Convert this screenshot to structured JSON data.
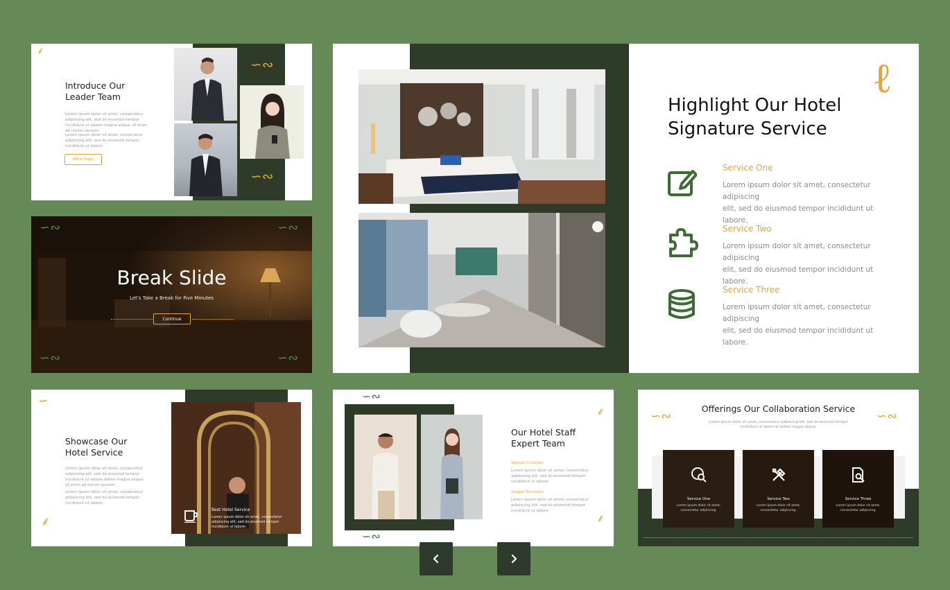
{
  "slide1": {
    "title": "Introduce Our Leader Team",
    "paragraph1": "Lorem ipsum dolor sit amet, consectetur adipiscing elit, sed do eiusmod tempor incididunt ut labore magna aliqua. Ut enim ad minim veniam.",
    "paragraph2": "Lorem ipsum dolor sit amet, consectetur adipiscing elit, sed do eiusmod tempor incididunt ut labore.",
    "button": "More Team"
  },
  "slide2": {
    "title": "Break Slide",
    "subtitle": "Let's Take a Break for Five Minutes",
    "button": "Continue"
  },
  "main": {
    "title_line1": "Highlight Our Hotel",
    "title_line2": "Signature Service",
    "services": [
      {
        "icon": "edit-icon",
        "title": "Service One",
        "desc1": "Lorem ipsum dolor sit amet, consectetur adipiscing",
        "desc2": "elit, sed do eiusmod tempor incididunt ut labore."
      },
      {
        "icon": "puzzle-icon",
        "title": "Service Two",
        "desc1": "Lorem ipsum dolor sit amet, consectetur adipiscing",
        "desc2": "elit, sed do eiusmod tempor incididunt ut labore."
      },
      {
        "icon": "database-icon",
        "title": "Service Three",
        "desc1": "Lorem ipsum dolor sit amet, consectetur adipiscing",
        "desc2": "elit, sed do eiusmod tempor incididunt ut labore."
      }
    ]
  },
  "slide4": {
    "title": "Showcase Our Hotel Service",
    "paragraph1": "Lorem ipsum dolor sit amet, consectetur adipiscing elit, sed do eiusmod tempor incididunt ut labore dolore magna aliqua. Ut enim ad minim veniam.",
    "paragraph2": "Lorem ipsum dolor sit amet, consectetur adipiscing elit, sed do eiusmod tempor incididunt ut labore.",
    "caption_title": "Best Hotel Service",
    "caption_text": "Lorem ipsum dolor sit amet, consectetur adipiscing elit, sed do eiusmod tempor incididunt ut labore."
  },
  "slide5": {
    "title": "Our Hotel Staff Expert Team",
    "member1": "Samuel Christian",
    "member1_text": "Lorem ipsum dolor sit amet, consectetur adipiscing elit, sed do eiusmod tempor incididunt ut labore.",
    "member2": "Sergen Romanov",
    "member2_text": "Lorem ipsum dolor sit amet, consectetur adipiscing elit, sed do eiusmod tempor incididunt ut labore."
  },
  "slide6": {
    "title": "Offerings Our Collaboration Service",
    "subtitle": "Lorem ipsum dolor sit amet, consectetur adipiscing elit, sed do eiusmod tempor incididunt ut labore et dolore magna aliqua.",
    "cards": [
      {
        "icon": "globe-search-icon",
        "title": "Service One",
        "text": "Lorem ipsum dolor sit amet, consectetur adipiscing."
      },
      {
        "icon": "tools-icon",
        "title": "Service Two",
        "text": "Lorem ipsum dolor sit amet, consectetur adipiscing."
      },
      {
        "icon": "document-search-icon",
        "title": "Service Three",
        "text": "Lorem ipsum dolor sit amet, consectetur adipiscing."
      }
    ]
  },
  "nav": {
    "prev_icon": "chevron-left-icon",
    "next_icon": "chevron-right-icon"
  },
  "colors": {
    "background": "#658a58",
    "dark_green": "#2d3b28",
    "accent_gold": "#e3a72f",
    "icon_green": "#3c6b34"
  }
}
